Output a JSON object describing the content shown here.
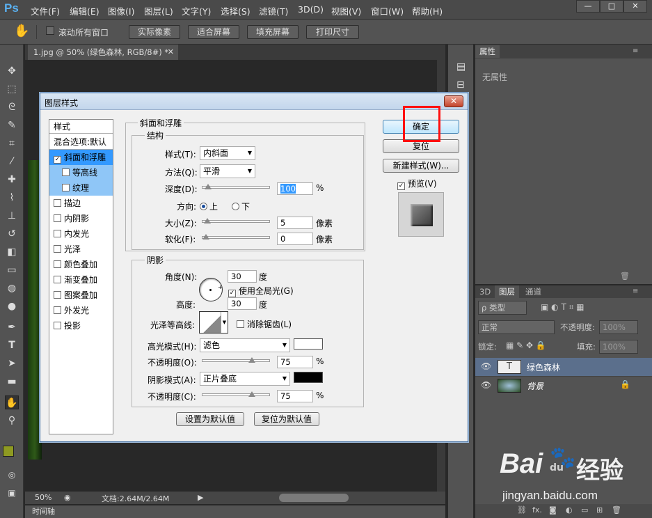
{
  "app": {
    "logo": "Ps"
  },
  "menu": [
    "文件(F)",
    "编辑(E)",
    "图像(I)",
    "图层(L)",
    "文字(Y)",
    "选择(S)",
    "滤镜(T)",
    "3D(D)",
    "视图(V)",
    "窗口(W)",
    "帮助(H)"
  ],
  "window_controls": [
    "—",
    "□",
    "✕"
  ],
  "options_bar": {
    "scroll_all_label": "滚动所有窗口",
    "buttons": [
      "实际像素",
      "适合屏幕",
      "填充屏幕",
      "打印尺寸"
    ]
  },
  "document": {
    "tab_title": "1.jpg @ 50% (绿色森林, RGB/8#) *",
    "zoom": "50%",
    "doc_info": "文档:2.64M/2.64M",
    "timeline": "时间轴"
  },
  "properties_panel": {
    "tab": "属性",
    "content": "无属性"
  },
  "layers_panel": {
    "tabs": [
      "3D",
      "图层",
      "通道"
    ],
    "filter_label": "ρ 类型",
    "blend_mode": "正常",
    "opacity_label": "不透明度:",
    "opacity_value": "100%",
    "lock_label": "锁定:",
    "fill_label": "填充:",
    "fill_value": "100%",
    "layers": [
      {
        "name": "绿色森林",
        "thumb": "T"
      },
      {
        "name": "背景"
      }
    ]
  },
  "dialog": {
    "title": "图层样式",
    "styles_header": "样式",
    "blend_options": "混合选项:默认",
    "style_items": [
      {
        "label": "斜面和浮雕",
        "checked": true,
        "state": "selected"
      },
      {
        "label": "等高线",
        "checked": false,
        "state": "sub"
      },
      {
        "label": "纹理",
        "checked": false,
        "state": "sub"
      },
      {
        "label": "描边",
        "checked": false
      },
      {
        "label": "内阴影",
        "checked": false
      },
      {
        "label": "内发光",
        "checked": false
      },
      {
        "label": "光泽",
        "checked": false
      },
      {
        "label": "颜色叠加",
        "checked": false
      },
      {
        "label": "渐变叠加",
        "checked": false
      },
      {
        "label": "图案叠加",
        "checked": false
      },
      {
        "label": "外发光",
        "checked": false
      },
      {
        "label": "投影",
        "checked": false
      }
    ],
    "bevel": {
      "section": "斜面和浮雕",
      "structure": "结构",
      "style_label": "样式(T):",
      "style_value": "内斜面",
      "technique_label": "方法(Q):",
      "technique_value": "平滑",
      "depth_label": "深度(D):",
      "depth_value": "100",
      "depth_percent": 0.03,
      "percent": "%",
      "direction_label": "方向:",
      "dir_up": "上",
      "dir_down": "下",
      "size_label": "大小(Z):",
      "size_value": "5",
      "size_level": 0.02,
      "soften_label": "软化(F):",
      "soften_value": "0",
      "soften_level": 0.0,
      "pixels": "像素"
    },
    "shading": {
      "section": "阴影",
      "angle_label": "角度(N):",
      "angle_value": "30",
      "degree": "度",
      "global_light": "使用全局光(G)",
      "altitude_label": "高度:",
      "altitude_value": "30",
      "gloss_contour_label": "光泽等高线:",
      "anti_alias": "消除锯齿(L)",
      "highlight_mode_label": "高光模式(H):",
      "highlight_mode_value": "滤色",
      "highlight_color": "#ffffff",
      "opacity_label": "不透明度(O):",
      "highlight_opacity": "75",
      "highlight_opacity_level": 0.75,
      "shadow_mode_label": "阴影模式(A):",
      "shadow_mode_value": "正片叠底",
      "shadow_color": "#000000",
      "opacity_label2": "不透明度(C):",
      "shadow_opacity": "75",
      "shadow_opacity_level": 0.75
    },
    "buttons": {
      "ok": "确定",
      "reset": "复位",
      "new_style": "新建样式(W)...",
      "preview": "预览(V)",
      "set_default": "设置为默认值",
      "reset_default": "复位为默认值"
    }
  },
  "watermark": {
    "brand": "Bai",
    "paw": "du",
    "cn": "经验",
    "url": "jingyan.baidu.com"
  },
  "colors": {
    "foreground": "#8e9a22",
    "background": "#ffffff",
    "highlight_box": "#ff1010"
  }
}
